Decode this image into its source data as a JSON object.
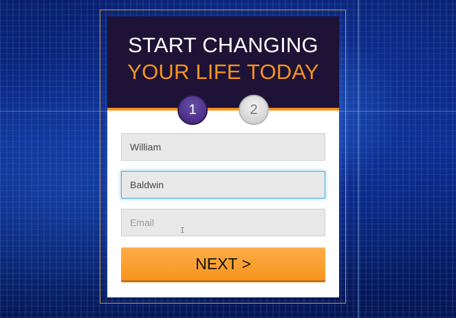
{
  "header": {
    "title_line1": "START CHANGING",
    "title_line2": "YOUR LIFE TODAY"
  },
  "steps": [
    {
      "label": "1",
      "state": "active"
    },
    {
      "label": "2",
      "state": "inactive"
    }
  ],
  "form": {
    "first_name_value": "William",
    "last_name_value": "Baldwin",
    "email_placeholder": "Email",
    "email_value": ""
  },
  "next_button_label": "NEXT >",
  "colors": {
    "accent": "#f7941d",
    "header_bg": "#1e1336",
    "active_step": "#4b2f86",
    "focus_border": "#4ab0e6"
  }
}
